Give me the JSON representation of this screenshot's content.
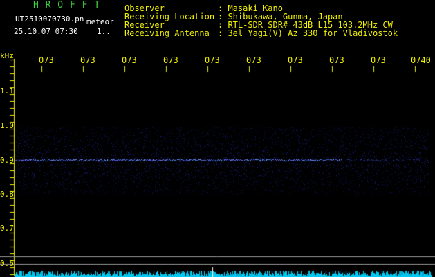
{
  "header": {
    "brand": "H R O F F T",
    "filename": "UT2510070730.pn",
    "mode": "meteor",
    "datetime": "25.10.07 07:30",
    "count": "1..",
    "fields": [
      {
        "label": "Observer",
        "value": ": Masaki Kano"
      },
      {
        "label": "Receiving Location",
        "value": ": Shibukawa, Gunma, Japan"
      },
      {
        "label": "Receiver",
        "value": ": RTL-SDR SDR# 43dB L15 103.2MHz CW"
      },
      {
        "label": "Receiving Antenna",
        "value": ": 3el Yagi(V) Az 330 for Vladivostok"
      }
    ]
  },
  "time_axis": {
    "labels": [
      "073",
      "073",
      "073",
      "073",
      "073",
      "073",
      "073",
      "073",
      "073",
      "0740"
    ]
  },
  "freq_axis": {
    "unit": "kHz",
    "labels": [
      "1.1",
      "1.0",
      "0.9",
      "0.8",
      "0.7",
      "0.6"
    ]
  },
  "colors": {
    "background": "#000000",
    "header_green": "#3fd13f",
    "header_yellow": "#f0f000",
    "signal_blue": "#3040ff",
    "noise_cyan": "#00d0ff",
    "gridline": "#9a9a9a"
  }
}
